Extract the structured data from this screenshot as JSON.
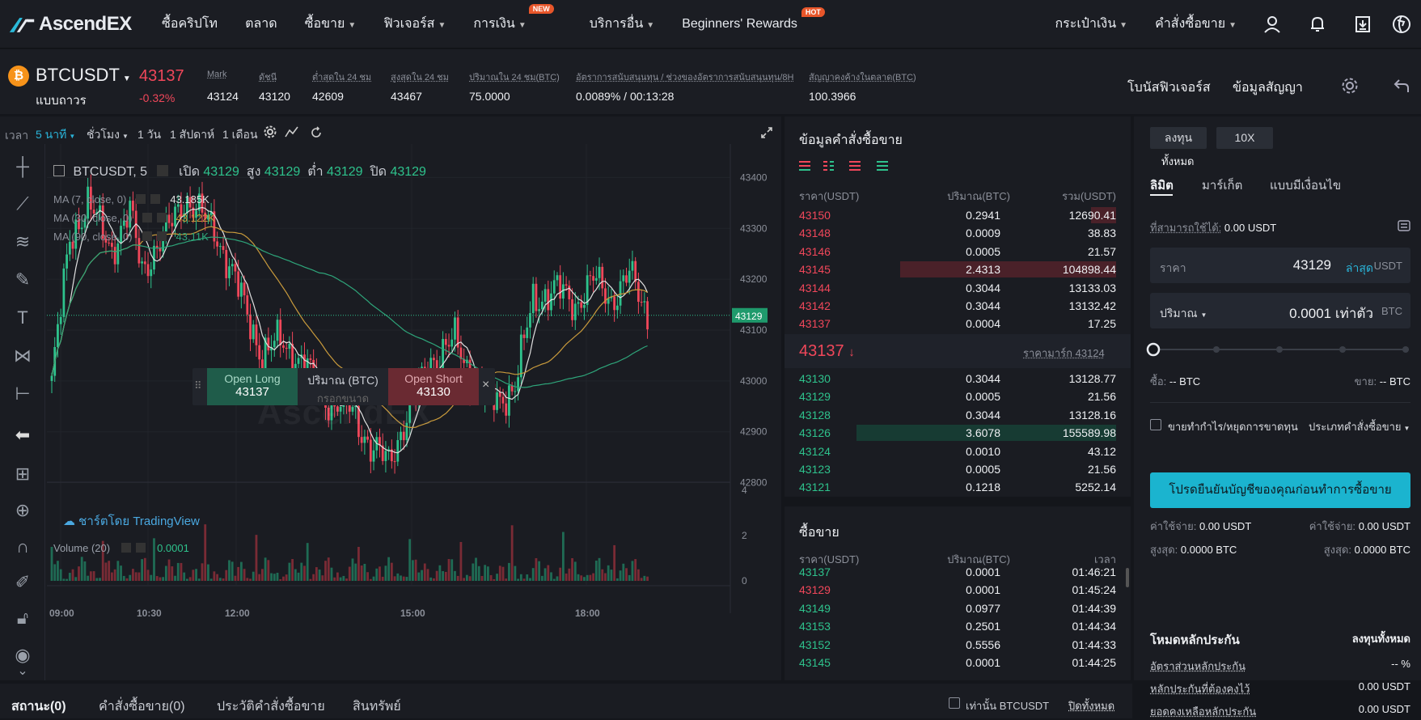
{
  "nav": {
    "brand": "AscendEX",
    "items": [
      {
        "label": "ซื้อคริปโท",
        "caret": false
      },
      {
        "label": "ตลาด",
        "caret": false
      },
      {
        "label": "ซื้อขาย",
        "caret": true
      },
      {
        "label": "ฟิวเจอร์ส",
        "caret": true
      },
      {
        "label": "การเงิน",
        "caret": true,
        "tag": "NEW"
      },
      {
        "label": "บริการอื่น",
        "caret": true
      },
      {
        "label": "Beginners' Rewards",
        "caret": false,
        "tag": "HOT"
      }
    ],
    "right": {
      "wallet": "กระเป๋าเงิน",
      "orders": "คำสั่งซื้อขาย"
    },
    "icons": [
      "user-icon",
      "bell-icon",
      "download-icon",
      "globe-icon"
    ]
  },
  "ticker": {
    "symbol": "BTCUSDT",
    "subtitle": "แบบถาวร",
    "last_price": "43137",
    "change": "-0.32%",
    "stats": [
      {
        "label": "Mark",
        "value": "43124"
      },
      {
        "label": "ดัชนี",
        "value": "43120"
      },
      {
        "label": "ต่ำสุดใน 24 ชม",
        "value": "42609"
      },
      {
        "label": "สูงสุดใน 24 ชม",
        "value": "43467"
      },
      {
        "label": "ปริมาณใน 24 ชม(BTC)",
        "value": "75.0000"
      },
      {
        "label": "อัตราการสนับสนุนทุน / ช่วงของอัตราการสนับสนุนทุน/8H",
        "value": "0.0089% / 00:13:28"
      },
      {
        "label": "สัญญาคงค้างในตลาด(BTC)",
        "value": "100.3966"
      }
    ],
    "links": {
      "bonus": "โบนัสฟิวเจอร์ส",
      "contract_info": "ข้อมูลสัญญา"
    }
  },
  "chart_toolbar": {
    "time_label": "เวลา",
    "intervals": [
      {
        "label": "5 นาที",
        "active": true,
        "caret": true
      },
      {
        "label": "ชั่วโมง",
        "active": false,
        "caret": true
      },
      {
        "label": "1 วัน",
        "active": false,
        "caret": false
      },
      {
        "label": "1 สัปดาห์",
        "active": false,
        "caret": false
      },
      {
        "label": "1 เดือน",
        "active": false,
        "caret": false
      }
    ]
  },
  "chart_legend": {
    "title": "BTCUSDT, 5",
    "open_label": "เปิด",
    "open": "43129",
    "high_label": "สูง",
    "high": "43129",
    "low_label": "ต่ำ",
    "low": "43129",
    "close_label": "ปิด",
    "close": "43129",
    "ma": [
      {
        "label": "MA (7, close, 0)",
        "value": "43.185K",
        "color": "#e0e0e0"
      },
      {
        "label": "MA (30, close, 0)",
        "value": "43.122K",
        "color": "#c89a3c"
      },
      {
        "label": "MA (90, close, 0)",
        "value": "43.11K",
        "color": "#2ea57a"
      }
    ],
    "volume_label": "Volume (20)",
    "volume_value": "0.0001",
    "attribution": "ชาร์ตโดย TradingView",
    "watermark": "AscendEX"
  },
  "quick_trade": {
    "open_long_label": "Open Long",
    "open_long_price": "43137",
    "qty_label": "ปริมาณ (BTC)",
    "qty_placeholder": "กรอกขนาด",
    "open_short_label": "Open Short",
    "open_short_price": "43130"
  },
  "chart_data": {
    "type": "candlestick",
    "y_ticks": [
      "43400",
      "43300",
      "43200",
      "43100",
      "43000",
      "42900",
      "42800"
    ],
    "volume_ticks": [
      "4",
      "2",
      "0"
    ],
    "x_ticks": [
      "09:00",
      "10:30",
      "12:00",
      "15:00",
      "18:00"
    ],
    "current_price_label": "43129",
    "ylim": [
      42750,
      43450
    ]
  },
  "orderbook": {
    "title": "ข้อมูลคำสั่งซื้อขาย",
    "headers": {
      "price": "ราคา(USDT)",
      "amount": "ปริมาณ(BTC)",
      "total": "รวม(USDT)"
    },
    "asks": [
      {
        "price": "43150",
        "amount": "0.2941",
        "total": "12690.41",
        "depth": 0.08
      },
      {
        "price": "43148",
        "amount": "0.0009",
        "total": "38.83",
        "depth": 0.0
      },
      {
        "price": "43146",
        "amount": "0.0005",
        "total": "21.57",
        "depth": 0.0
      },
      {
        "price": "43145",
        "amount": "2.4313",
        "total": "104898.44",
        "depth": 0.68
      },
      {
        "price": "43144",
        "amount": "0.3044",
        "total": "13133.03",
        "depth": 0.0
      },
      {
        "price": "43142",
        "amount": "0.3044",
        "total": "13132.42",
        "depth": 0.0
      },
      {
        "price": "43137",
        "amount": "0.0004",
        "total": "17.25",
        "depth": 0.0
      }
    ],
    "mid_price": "43137",
    "mark_label": "ราคามาร์ก 43124",
    "bids": [
      {
        "price": "43130",
        "amount": "0.3044",
        "total": "13128.77",
        "depth": 0.0
      },
      {
        "price": "43129",
        "amount": "0.0005",
        "total": "21.56",
        "depth": 0.0
      },
      {
        "price": "43128",
        "amount": "0.3044",
        "total": "13128.16",
        "depth": 0.0
      },
      {
        "price": "43126",
        "amount": "3.6078",
        "total": "155589.98",
        "depth": 0.82
      },
      {
        "price": "43124",
        "amount": "0.0010",
        "total": "43.12",
        "depth": 0.0
      },
      {
        "price": "43123",
        "amount": "0.0005",
        "total": "21.56",
        "depth": 0.0
      },
      {
        "price": "43121",
        "amount": "0.1218",
        "total": "5252.14",
        "depth": 0.0
      }
    ]
  },
  "trades": {
    "title": "ซื้อขาย",
    "headers": {
      "price": "ราคา(USDT)",
      "amount": "ปริมาณ(BTC)",
      "time": "เวลา"
    },
    "rows": [
      {
        "price": "43137",
        "amount": "0.0001",
        "time": "01:46:21",
        "side": "buy"
      },
      {
        "price": "43129",
        "amount": "0.0001",
        "time": "01:45:24",
        "side": "sell"
      },
      {
        "price": "43149",
        "amount": "0.0977",
        "time": "01:44:39",
        "side": "buy"
      },
      {
        "price": "43153",
        "amount": "0.2501",
        "time": "01:44:34",
        "side": "buy"
      },
      {
        "price": "43152",
        "amount": "0.5556",
        "time": "01:44:33",
        "side": "buy"
      },
      {
        "price": "43145",
        "amount": "0.0001",
        "time": "01:44:25",
        "side": "buy"
      }
    ]
  },
  "order_form": {
    "mode_btn": "ลงทุน",
    "mode_btn_sub": "ทั้งหมด",
    "leverage": "10X",
    "tabs": [
      "ลิมิต",
      "มาร์เก็ต",
      "แบบมีเงื่อนไข"
    ],
    "available_label": "ที่สามารถใช้ได้:",
    "available_value": "0.00 USDT",
    "price_label": "ราคา",
    "price_value": "43129",
    "price_link": "ล่าสุด",
    "price_unit": "USDT",
    "qty_label": "ปริมาณ",
    "qty_value": "0.0001 เท่าตัว",
    "qty_unit": "BTC",
    "buy_label": "ซื้อ:",
    "buy_value": "-- BTC",
    "sell_label": "ขาย:",
    "sell_value": "-- BTC",
    "tpsl_label": "ขายทำกำไร/หยุดการขาดทุน",
    "order_type_label": "ประเภทคำสั่งซื้อขาย",
    "submit_label": "โปรดยืนยันบัญชีของคุณก่อนทำการซื้อขาย",
    "fee_left_label": "ค่าใช้จ่าย:",
    "fee_left": "0.00 USDT",
    "fee_right_label": "ค่าใช้จ่าย:",
    "fee_right": "0.00 USDT",
    "max_left_label": "สูงสุด:",
    "max_left": "0.0000 BTC",
    "max_right_label": "สูงสุด:",
    "max_right": "0.0000 BTC"
  },
  "margin": {
    "title": "โหมดหลักประกัน",
    "mode": "ลงทุนทั้งหมด",
    "rows": [
      {
        "label": "อัตราส่วนหลักประกัน",
        "value": "-- %"
      },
      {
        "label": "หลักประกันที่ต้องคงไว้",
        "value": "0.00 USDT"
      },
      {
        "label": "ยอดคงเหลือหลักประกัน",
        "value": "0.00 USDT"
      }
    ]
  },
  "bottom": {
    "tabs": [
      "สถานะ(0)",
      "คำสั่งซื้อขาย(0)",
      "ประวัติคำสั่งซื้อขาย",
      "สินทรัพย์"
    ],
    "only_symbol": "เท่านั้น BTCUSDT",
    "close_all": "ปิดทั้งหมด"
  }
}
